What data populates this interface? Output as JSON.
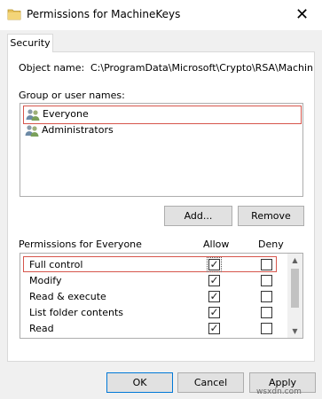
{
  "window": {
    "title": "Permissions for MachineKeys",
    "close_glyph": "✕"
  },
  "tabs": [
    {
      "label": "Security",
      "active": true
    }
  ],
  "object": {
    "label": "Object name:",
    "value": "C:\\ProgramData\\Microsoft\\Crypto\\RSA\\MachineK"
  },
  "groups": {
    "label": "Group or user names:",
    "items": [
      {
        "name": "Everyone",
        "selected": true,
        "icon": "users-icon"
      },
      {
        "name": "Administrators",
        "selected": false,
        "icon": "users-icon"
      }
    ]
  },
  "buttons": {
    "add": "Add...",
    "remove": "Remove",
    "ok": "OK",
    "cancel": "Cancel",
    "apply": "Apply"
  },
  "permissions": {
    "label": "Permissions for Everyone",
    "allow_header": "Allow",
    "deny_header": "Deny",
    "rows": [
      {
        "name": "Full control",
        "allow": true,
        "deny": false
      },
      {
        "name": "Modify",
        "allow": true,
        "deny": false
      },
      {
        "name": "Read & execute",
        "allow": true,
        "deny": false
      },
      {
        "name": "List folder contents",
        "allow": true,
        "deny": false
      },
      {
        "name": "Read",
        "allow": true,
        "deny": false
      },
      {
        "name": "",
        "allow": true,
        "deny": false
      }
    ]
  },
  "watermark": "wsxdn.com",
  "colors": {
    "highlight_border": "#d6564c",
    "default_button_border": "#0078d7"
  }
}
